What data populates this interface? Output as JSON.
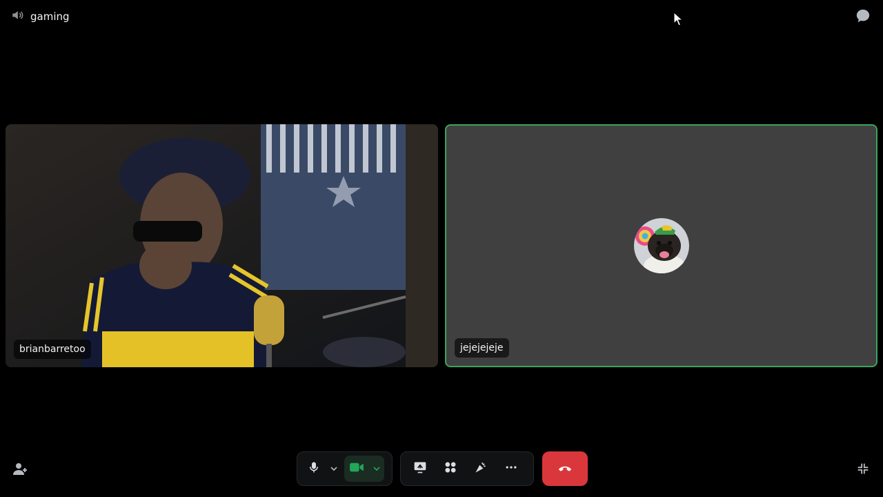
{
  "header": {
    "channel_name": "gaming",
    "channel_icon": "speaker-icon",
    "chat_icon": "chat-bubble-icon"
  },
  "participants": [
    {
      "name": "brianbarretoo",
      "video": "camera-feed",
      "speaking": false
    },
    {
      "name": "jejejejeje",
      "video": "avatar",
      "speaking": true
    }
  ],
  "controls": {
    "microphone_icon": "microphone-icon",
    "camera_icon": "camera-icon",
    "screen_share_icon": "screen-share-icon",
    "activities_icon": "activities-icon",
    "soundboard_icon": "soundboard-icon",
    "more_icon": "more-icon",
    "leave_icon": "hang-up-icon",
    "invite_icon": "add-user-icon",
    "collapse_icon": "collapse-icon"
  },
  "colors": {
    "speaking_border": "#3ba55d",
    "camera_active": "#23a55a",
    "leave": "#da373c",
    "background": "#000000"
  }
}
